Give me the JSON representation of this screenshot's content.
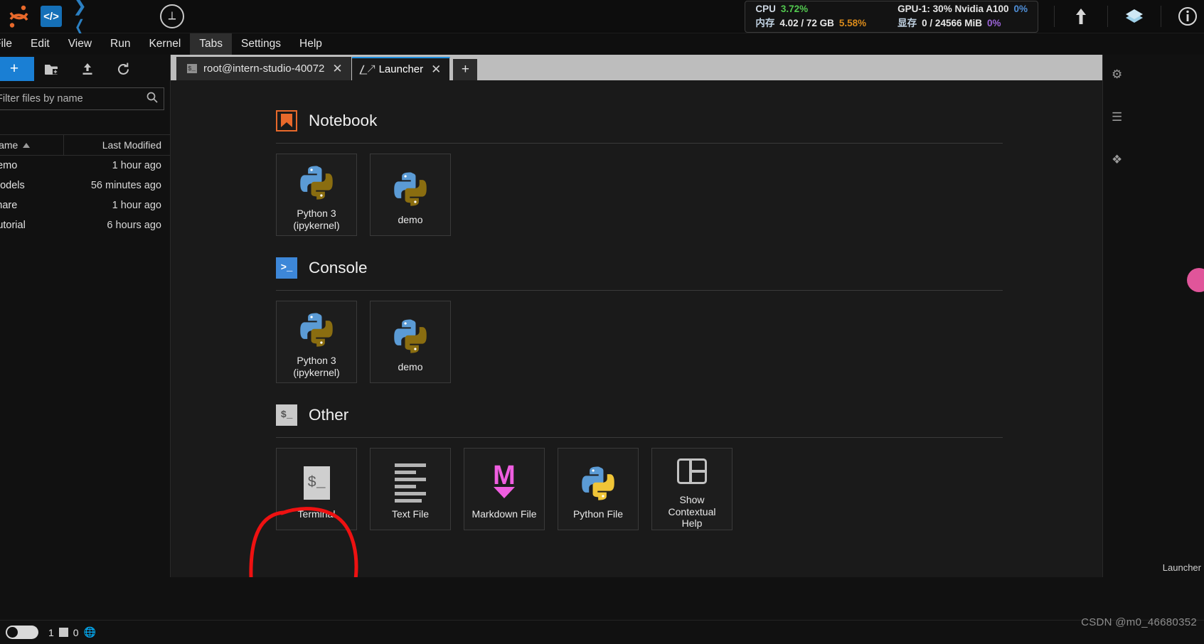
{
  "window": {
    "app_name": "JupyterLab",
    "icons": {
      "jupyter": "jupyter-logo-icon",
      "code": "code-brackets-icon",
      "vscode": "vscode-icon",
      "compass": "compass-icon",
      "upload_cloud": "upload-icon",
      "stack": "layers-icon",
      "info": "info-circle-icon"
    }
  },
  "sysmon": {
    "cpu_label": "CPU",
    "cpu_value": "3.72%",
    "mem_label": "内存",
    "mem_value": "4.02 / 72 GB",
    "mem_pct": "5.58%",
    "gpu_label": "GPU-1: 30% Nvidia A100",
    "gpu_pct": "0%",
    "vram_label": "显存",
    "vram_value": "0 / 24566 MiB",
    "vram_pct": "0%",
    "colors": {
      "green": "#52c94f",
      "orange": "#d98a1b",
      "blue": "#4f8fd8",
      "purple": "#9b63d8",
      "label": "#cfd8e3"
    }
  },
  "menubar": {
    "items": [
      {
        "label": "File",
        "active": false,
        "clipped": true
      },
      {
        "label": "Edit",
        "active": false
      },
      {
        "label": "View",
        "active": false
      },
      {
        "label": "Run",
        "active": false
      },
      {
        "label": "Kernel",
        "active": false
      },
      {
        "label": "Tabs",
        "active": true
      },
      {
        "label": "Settings",
        "active": false
      },
      {
        "label": "Help",
        "active": false
      }
    ]
  },
  "filebrowser": {
    "new_button_label": "+",
    "toolbar_icons": [
      "new-folder-icon",
      "upload-icon",
      "refresh-icon"
    ],
    "search_placeholder": "Filter files by name",
    "search_value": "",
    "search_icon": "search-icon",
    "breadcrumb": "/",
    "columns": {
      "name": "Name",
      "last_modified": "Last Modified"
    },
    "sort_icon": "sort-ascending-icon",
    "rows": [
      {
        "name": "demo",
        "modified": "1 hour ago"
      },
      {
        "name": "models",
        "modified": "56 minutes ago"
      },
      {
        "name": "share",
        "modified": "1 hour ago"
      },
      {
        "name": "Tutorial",
        "modified": "6 hours ago"
      }
    ]
  },
  "tabs": {
    "items": [
      {
        "label": "root@intern-studio-40072",
        "icon": "terminal-icon",
        "active": false,
        "closable": true
      },
      {
        "label": "Launcher",
        "icon": "launcher-icon",
        "active": true,
        "closable": true
      }
    ],
    "add_label": "+"
  },
  "launcher": {
    "sections": [
      {
        "title": "Notebook",
        "icon": "bookmark-icon",
        "icon_color": "#e8692b",
        "cards": [
          {
            "label": "Python 3\n(ipykernel)",
            "icon": "python-logo-icon"
          },
          {
            "label": "demo",
            "icon": "python-logo-icon"
          }
        ]
      },
      {
        "title": "Console",
        "icon": "terminal-prompt-icon",
        "icon_color": "#3d87d8",
        "cards": [
          {
            "label": "Python 3\n(ipykernel)",
            "icon": "python-logo-icon"
          },
          {
            "label": "demo",
            "icon": "python-logo-icon"
          }
        ]
      },
      {
        "title": "Other",
        "icon": "terminal-dollar-icon",
        "icon_color": "#c9c9c9",
        "cards": [
          {
            "label": "Terminal",
            "icon": "terminal-dollar-icon",
            "annotated": true
          },
          {
            "label": "Text File",
            "icon": "text-file-icon"
          },
          {
            "label": "Markdown File",
            "icon": "markdown-icon"
          },
          {
            "label": "Python File",
            "icon": "python-file-icon"
          },
          {
            "label": "Show\nContextual\nHelp",
            "icon": "contextual-help-icon"
          }
        ]
      }
    ],
    "annotation": {
      "shape": "hand-drawn-ellipse",
      "color": "#ee1111",
      "target": "Terminal"
    }
  },
  "rightbar": {
    "icons": [
      "settings-gear-icon",
      "table-of-contents-icon",
      "extension-icon"
    ],
    "vertical_label": "Launcher"
  },
  "statusbar": {
    "toggle_state": "off",
    "terminal_count": "1",
    "kernel_count": "0",
    "globe_icon": "globe-icon",
    "terminal_icon": "terminal-icon"
  },
  "watermark": {
    "line1": "CSDN @m0_46680352",
    "line2": "Launcher"
  }
}
